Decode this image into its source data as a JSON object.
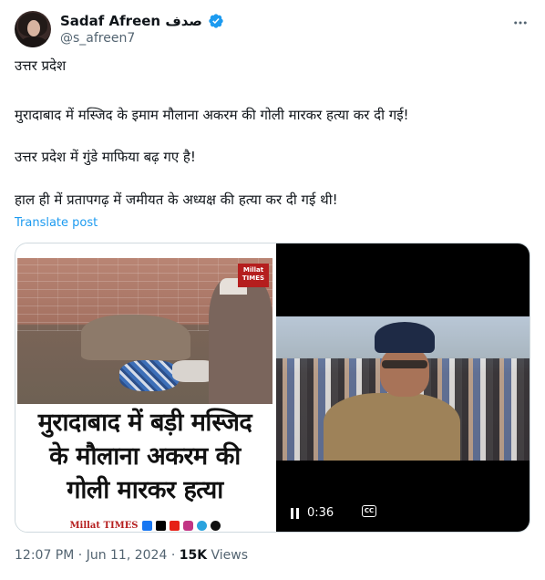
{
  "author": {
    "display_name": "Sadaf Afreen صدف",
    "handle": "@s_afreen7",
    "verified": true
  },
  "tweet": {
    "paragraphs": [
      "उत्तर प्रदेश",
      "मुरादाबाद में मस्जिद के इमाम मौलाना अकरम की गोली मारकर हत्या कर दी गई!",
      "उत्तर प्रदेश में गुंडे माफिया बढ़ गए है!",
      "हाल ही में प्रतापगढ़ में जमीयत के अध्यक्ष की हत्या कर दी गई थी!"
    ],
    "translate_label": "Translate post"
  },
  "media": {
    "image": {
      "logo_text_1": "Millat",
      "logo_text_2": "TIMES",
      "headline_lines": [
        "मुरादाबाद में बड़ी मस्जिद",
        "के मौलाना अकरम की",
        "गोली मारकर हत्या"
      ],
      "brand": "Millat TIMES",
      "social_icons": [
        "facebook-icon",
        "x-icon",
        "youtube-icon",
        "instagram-icon",
        "telegram-icon",
        "whatsapp-icon"
      ]
    },
    "video": {
      "time": "0:36",
      "cc_label": "CC"
    }
  },
  "footer": {
    "time": "12:07 PM",
    "separator": "·",
    "date": "Jun 11, 2024",
    "views_count": "15K",
    "views_label": "Views"
  },
  "colors": {
    "link": "#1d9bf0",
    "muted": "#536471",
    "verified": "#1d9bf0",
    "brand_red": "#b51e1e"
  }
}
